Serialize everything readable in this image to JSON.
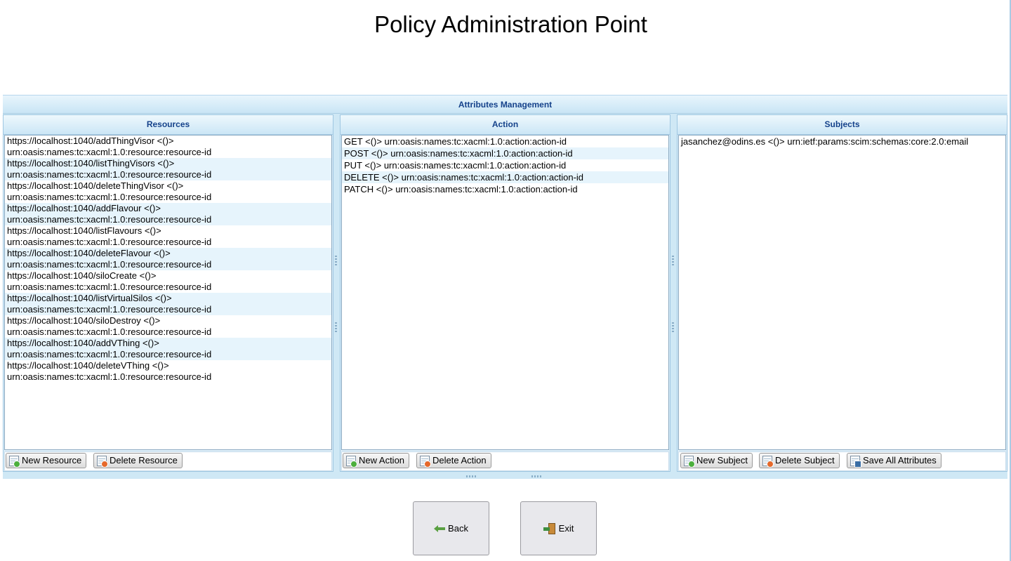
{
  "page": {
    "title": "Policy Administration Point"
  },
  "attributes_panel": {
    "title": "Attributes Management"
  },
  "resources": {
    "title": "Resources",
    "items": [
      {
        "url": "https://localhost:1040/addThingVisor <()>",
        "attr": "urn:oasis:names:tc:xacml:1.0:resource:resource-id"
      },
      {
        "url": "https://localhost:1040/listThingVisors <()>",
        "attr": "urn:oasis:names:tc:xacml:1.0:resource:resource-id"
      },
      {
        "url": "https://localhost:1040/deleteThingVisor <()>",
        "attr": "urn:oasis:names:tc:xacml:1.0:resource:resource-id"
      },
      {
        "url": "https://localhost:1040/addFlavour <()>",
        "attr": "urn:oasis:names:tc:xacml:1.0:resource:resource-id"
      },
      {
        "url": "https://localhost:1040/listFlavours <()>",
        "attr": "urn:oasis:names:tc:xacml:1.0:resource:resource-id"
      },
      {
        "url": "https://localhost:1040/deleteFlavour <()>",
        "attr": "urn:oasis:names:tc:xacml:1.0:resource:resource-id"
      },
      {
        "url": "https://localhost:1040/siloCreate <()>",
        "attr": "urn:oasis:names:tc:xacml:1.0:resource:resource-id"
      },
      {
        "url": "https://localhost:1040/listVirtualSilos <()>",
        "attr": "urn:oasis:names:tc:xacml:1.0:resource:resource-id"
      },
      {
        "url": "https://localhost:1040/siloDestroy <()>",
        "attr": "urn:oasis:names:tc:xacml:1.0:resource:resource-id"
      },
      {
        "url": "https://localhost:1040/addVThing <()>",
        "attr": "urn:oasis:names:tc:xacml:1.0:resource:resource-id"
      },
      {
        "url": "https://localhost:1040/deleteVThing <()>",
        "attr": "urn:oasis:names:tc:xacml:1.0:resource:resource-id"
      }
    ],
    "buttons": {
      "new": "New Resource",
      "delete": "Delete Resource"
    }
  },
  "actions": {
    "title": "Action",
    "items": [
      "GET <()> urn:oasis:names:tc:xacml:1.0:action:action-id",
      "POST <()> urn:oasis:names:tc:xacml:1.0:action:action-id",
      "PUT <()> urn:oasis:names:tc:xacml:1.0:action:action-id",
      "DELETE <()> urn:oasis:names:tc:xacml:1.0:action:action-id",
      "PATCH <()> urn:oasis:names:tc:xacml:1.0:action:action-id"
    ],
    "buttons": {
      "new": "New Action",
      "delete": "Delete Action"
    }
  },
  "subjects": {
    "title": "Subjects",
    "items": [
      "jasanchez@odins.es <()> urn:ietf:params:scim:schemas:core:2.0:email"
    ],
    "buttons": {
      "new": "New Subject",
      "delete": "Delete Subject",
      "save_all": "Save All Attributes"
    }
  },
  "footer": {
    "back": "Back",
    "exit": "Exit"
  },
  "colors": {
    "header_text": "#15428b",
    "panel_bg": "#cfe8f5",
    "alt_row": "#e6f4fc"
  }
}
